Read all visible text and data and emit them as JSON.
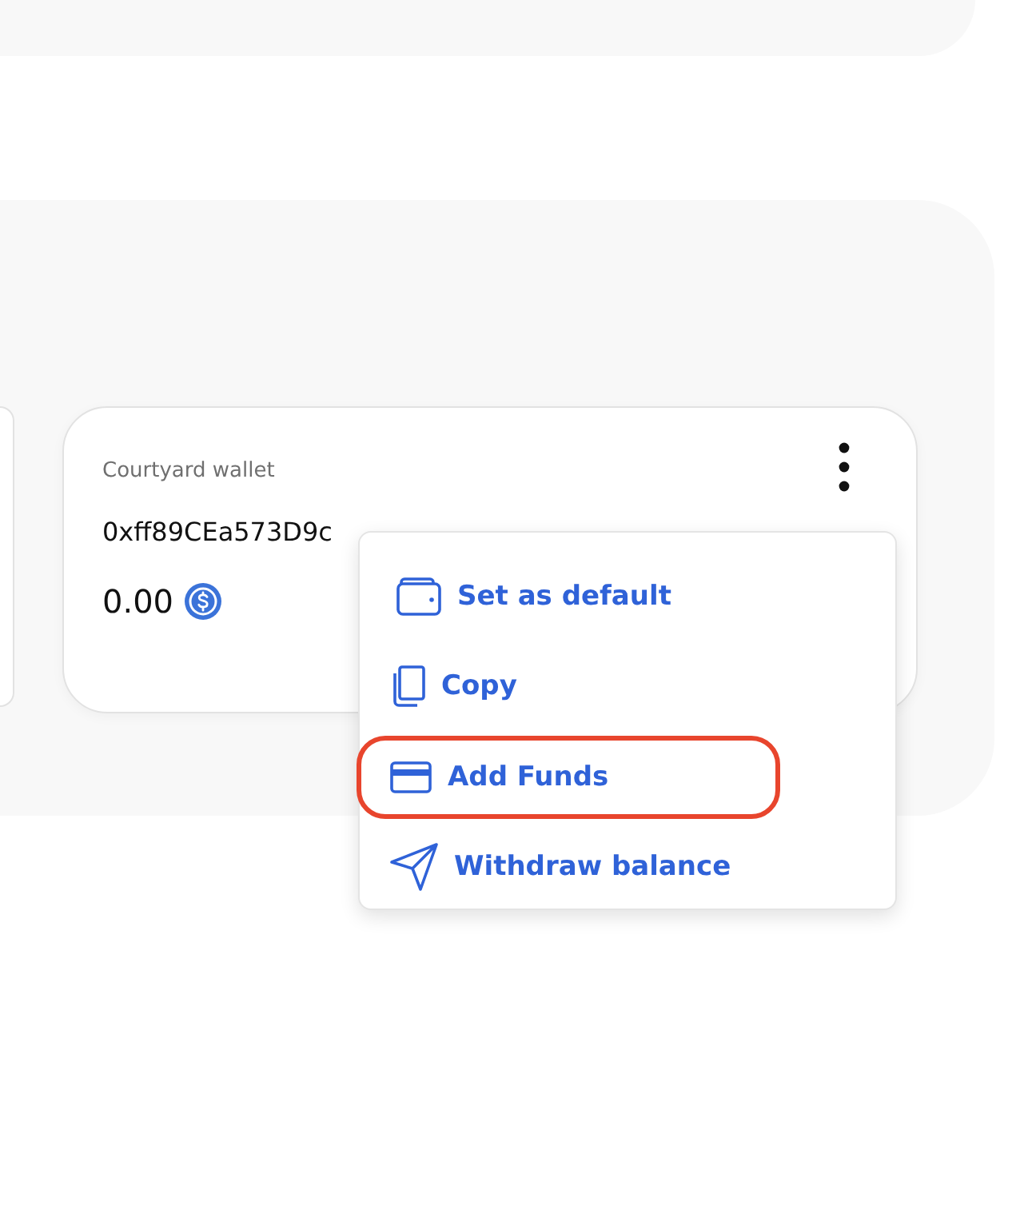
{
  "wallet_card": {
    "title": "Courtyard wallet",
    "address": "0xff89CEa573D9c",
    "balance": "0.00"
  },
  "menu": {
    "items": [
      {
        "kind": "wallet",
        "label": "Set as default",
        "highlighted": false
      },
      {
        "kind": "copy",
        "label": "Copy",
        "highlighted": false
      },
      {
        "kind": "card",
        "label": "Add Funds",
        "highlighted": true
      },
      {
        "kind": "send",
        "label": "Withdraw balance",
        "highlighted": false
      }
    ]
  }
}
